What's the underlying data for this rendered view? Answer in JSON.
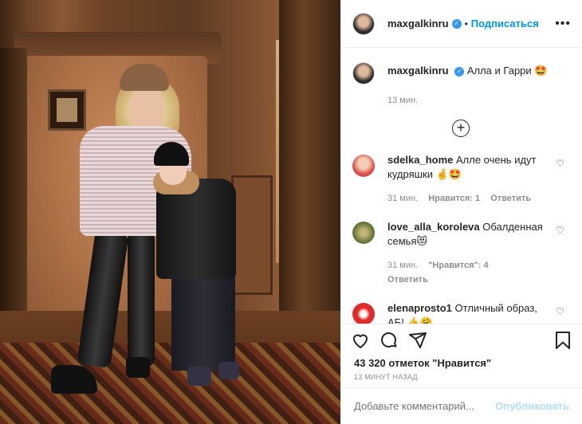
{
  "header": {
    "username": "maxgalkinru",
    "follow_label": "Подписаться",
    "dot": "•",
    "more": "•••"
  },
  "caption": {
    "username": "maxgalkinru",
    "text": "Алла и Гарри 🤩",
    "time": "13 мин."
  },
  "comments": [
    {
      "username": "sdelka_home",
      "text": "Алле очень идут кудряшки 🤞🤩",
      "time": "31 мин.",
      "likes": "Нравится: 1",
      "reply": "Ответить",
      "avatar_color": "#d94a4a"
    },
    {
      "username": "love_alla_koroleva",
      "text": "Обалденная семья😻",
      "time": "31 мин.",
      "likes": "\"Нравится\": 4",
      "reply": "Ответить",
      "avatar_color": "#6a7a3a"
    },
    {
      "username": "elenaprosto1",
      "text": "Отличный образ, АБ! 👍🤗",
      "time": "",
      "likes": "",
      "reply": "",
      "avatar_color": "#e02a2a"
    }
  ],
  "likes_text": "43 320 отметок \"Нравится\"",
  "post_time": "13 минут назад",
  "comment_box": {
    "placeholder": "Добавьте комментарий...",
    "publish": "Опубликовать"
  },
  "colors": {
    "accent": "#0095f6",
    "verified": "#3897f0",
    "muted": "#8e8e8e"
  },
  "icons": [
    "verified-icon",
    "more-icon",
    "load-more-icon",
    "heart-icon",
    "comment-icon",
    "share-icon",
    "bookmark-icon"
  ]
}
